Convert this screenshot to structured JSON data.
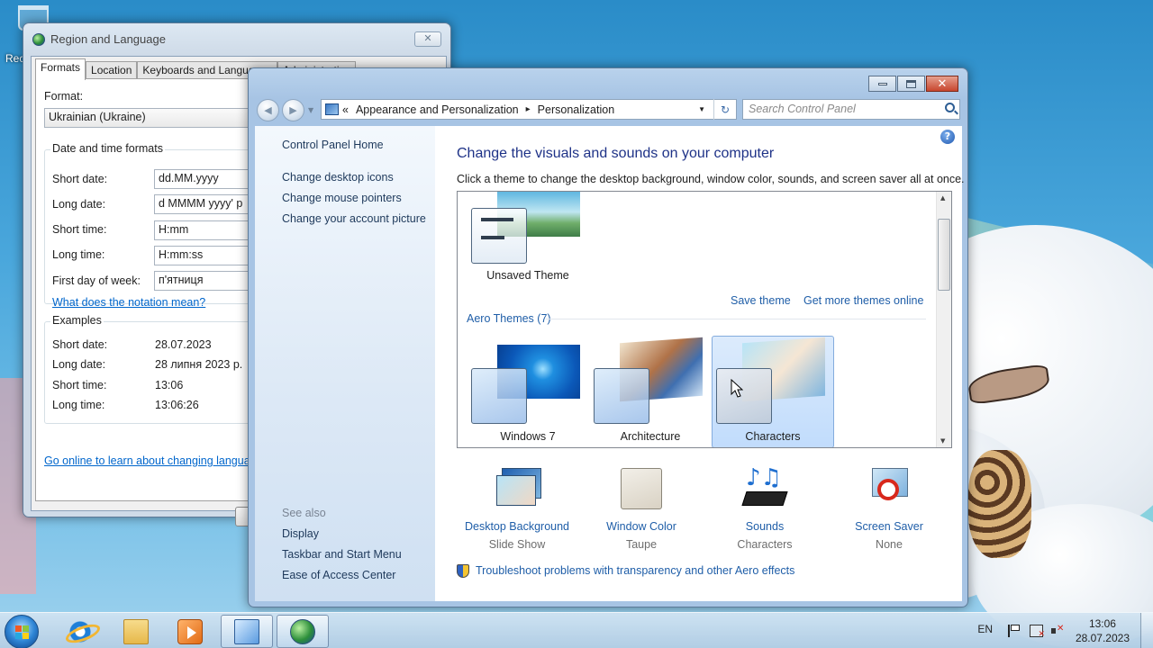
{
  "desktop": {
    "recycle_label": "Rec"
  },
  "region_dialog": {
    "title": "Region and Language",
    "close_glyph": "✕",
    "tabs": [
      "Formats",
      "Location",
      "Keyboards and Languages",
      "Administrative"
    ],
    "format_label": "Format:",
    "format_value": "Ukrainian (Ukraine)",
    "datetime_group": "Date and time formats",
    "fields": [
      {
        "label": "Short date:",
        "value": "dd.MM.yyyy"
      },
      {
        "label": "Long date:",
        "value": "d MMMM yyyy' p"
      },
      {
        "label": "Short time:",
        "value": "H:mm"
      },
      {
        "label": "Long time:",
        "value": "H:mm:ss"
      },
      {
        "label": "First day of week:",
        "value": "п'ятниця"
      }
    ],
    "notation_link": "What does the notation mean?",
    "examples_group": "Examples",
    "examples": [
      {
        "label": "Short date:",
        "value": "28.07.2023"
      },
      {
        "label": "Long date:",
        "value": "28 липня 2023 р."
      },
      {
        "label": "Short time:",
        "value": "13:06"
      },
      {
        "label": "Long time:",
        "value": "13:06:26"
      }
    ],
    "online_link": "Go online to learn about changing langua"
  },
  "personalization": {
    "address": {
      "chevrons": "«",
      "crumbs": [
        "Appearance and Personalization",
        "Personalization"
      ],
      "sep": "▸"
    },
    "search_placeholder": "Search Control Panel",
    "sidebar": {
      "home": "Control Panel Home",
      "tasks": [
        "Change desktop icons",
        "Change mouse pointers",
        "Change your account picture"
      ],
      "see_also_title": "See also",
      "see_also": [
        "Display",
        "Taskbar and Start Menu",
        "Ease of Access Center"
      ]
    },
    "heading": "Change the visuals and sounds on your computer",
    "subheading": "Click a theme to change the desktop background, window color, sounds, and screen saver all at once.",
    "help_glyph": "?",
    "unsaved_theme": "Unsaved Theme",
    "save_theme": "Save theme",
    "get_more": "Get more themes online",
    "aero_group": "Aero Themes (7)",
    "themes": [
      {
        "name": "Windows 7"
      },
      {
        "name": "Architecture"
      },
      {
        "name": "Characters",
        "selected": true
      }
    ],
    "settings": [
      {
        "name": "Desktop Background",
        "value": "Slide Show",
        "icon": "desktop-background-icon"
      },
      {
        "name": "Window Color",
        "value": "Taupe",
        "icon": "window-color-icon"
      },
      {
        "name": "Sounds",
        "value": "Characters",
        "icon": "sounds-icon"
      },
      {
        "name": "Screen Saver",
        "value": "None",
        "icon": "screen-saver-icon"
      }
    ],
    "troubleshoot": "Troubleshoot problems with transparency and other Aero effects"
  },
  "taskbar": {
    "language": "EN",
    "time": "13:06",
    "date": "28.07.2023"
  }
}
